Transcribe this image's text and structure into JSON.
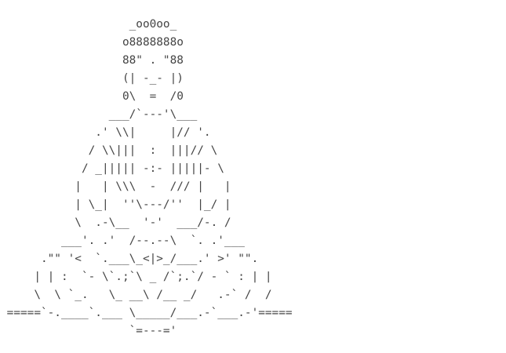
{
  "ascii_art": {
    "lines": [
      "                   _oo0oo_",
      "                  o8888888o",
      "                  88\" . \"88",
      "                  (| -_- |)",
      "                  0\\  =  /0",
      "                ___/`---'\\___",
      "              .' \\\\|     |// '.",
      "             / \\\\|||  :  |||// \\",
      "            / _||||| -:- |||||- \\",
      "           |   | \\\\\\  -  /// |   |",
      "           | \\_|  ''\\---/''  |_/ |",
      "           \\  .-\\__  '-'  ___/-. /",
      "         ___'. .'  /--.--\\  `. .'___",
      "      .\"\" '<  `.___\\_<|>_/___.' >' \"\".",
      "     | | :  `- \\`.;`\\ _ /`;.`/ - ` : | |",
      "     \\  \\ `_.   \\_ __\\ /__ _/   .-` /  /",
      " =====`-.____`.___ \\_____/___.-`___.-'=====",
      "                   `=---='"
    ]
  }
}
